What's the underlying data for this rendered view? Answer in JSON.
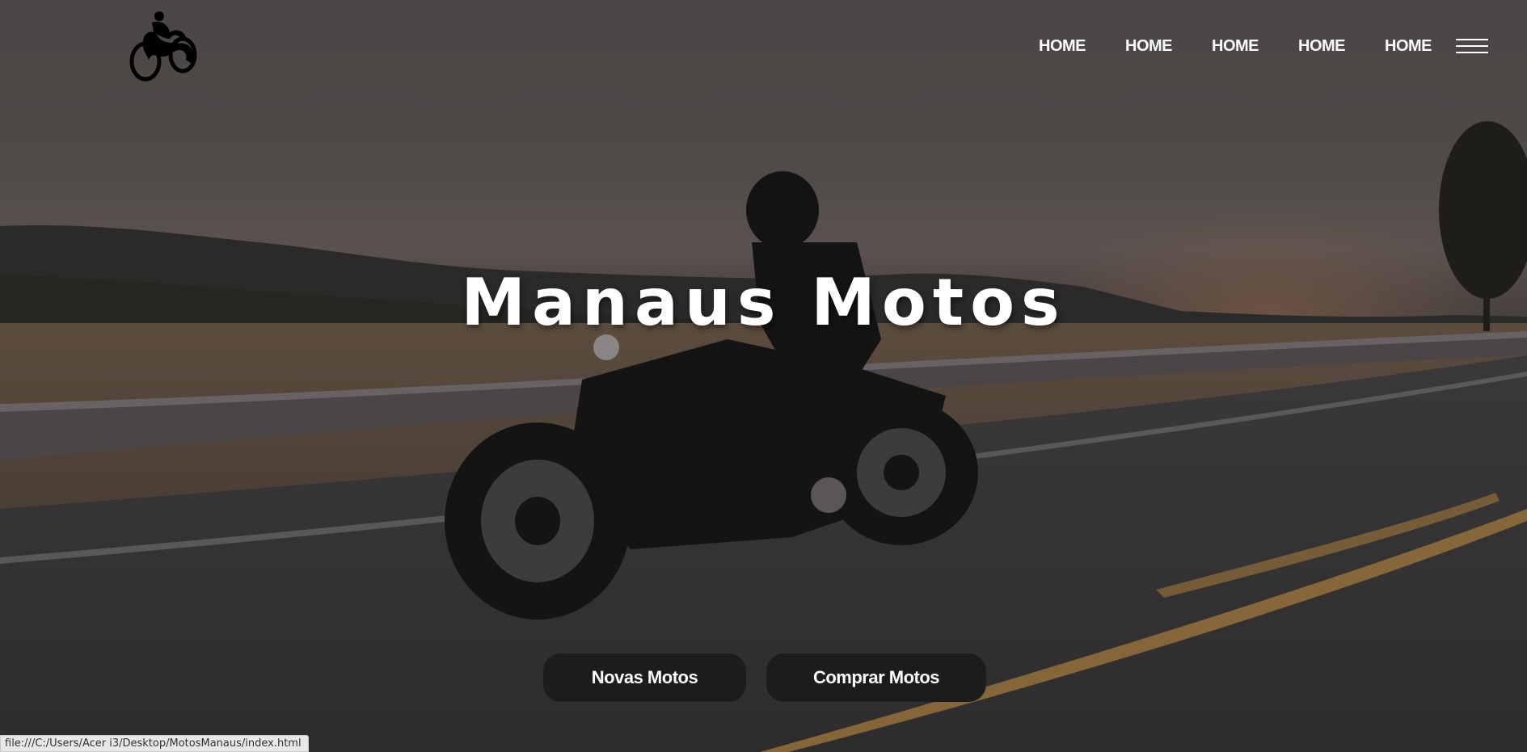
{
  "nav": {
    "links": [
      "HOME",
      "HOME",
      "HOME",
      "HOME",
      "HOME"
    ]
  },
  "hero": {
    "title": "Manaus Motos"
  },
  "buttons": {
    "novas": "Novas Motos",
    "comprar": "Comprar Motos"
  },
  "status_bar": {
    "url": "file:///C:/Users/Acer i3/Desktop/MotosManaus/index.html"
  },
  "icons": {
    "logo": "motorcycle-rider-icon",
    "menu": "hamburger-menu-icon"
  },
  "colors": {
    "button_bg": "#1d1c1c",
    "text": "#ffffff"
  }
}
